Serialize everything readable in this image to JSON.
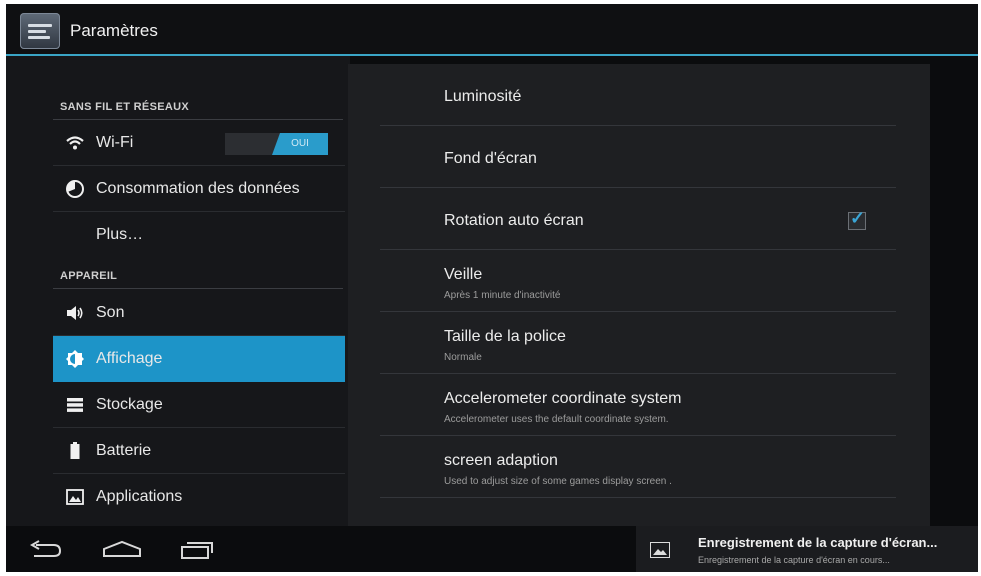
{
  "action_bar": {
    "title": "Paramètres",
    "accent": "#3aa5c6"
  },
  "sidebar": {
    "section_wireless": "SANS FIL ET RÉSEAUX",
    "section_device": "APPAREIL",
    "wifi_toggle": "OUI",
    "items": [
      {
        "label": "Wi-Fi",
        "icon": "wifi-icon"
      },
      {
        "label": "Consommation des données",
        "icon": "data-usage-icon"
      },
      {
        "label": "Plus…",
        "icon": ""
      },
      {
        "label": "Son",
        "icon": "speaker-icon"
      },
      {
        "label": "Affichage",
        "icon": "brightness-icon"
      },
      {
        "label": "Stockage",
        "icon": "storage-icon"
      },
      {
        "label": "Batterie",
        "icon": "battery-icon"
      },
      {
        "label": "Applications",
        "icon": "applications-icon"
      }
    ],
    "selected_color": "#1d94c8"
  },
  "display_settings": [
    {
      "title": "Luminosité",
      "summary": ""
    },
    {
      "title": "Fond d'écran",
      "summary": ""
    },
    {
      "title": "Rotation auto écran",
      "summary": "",
      "checked": true
    },
    {
      "title": "Veille",
      "summary": "Après 1 minute d'inactivité"
    },
    {
      "title": "Taille de la police",
      "summary": "Normale"
    },
    {
      "title": "Accelerometer coordinate system",
      "summary": "Accelerometer uses the default coordinate system."
    },
    {
      "title": "screen adaption",
      "summary": "Used to adjust size of some games display screen ."
    }
  ],
  "notification": {
    "title": "Enregistrement de la capture d'écran...",
    "subtitle": "Enregistrement de la capture d'écran en cours..."
  }
}
